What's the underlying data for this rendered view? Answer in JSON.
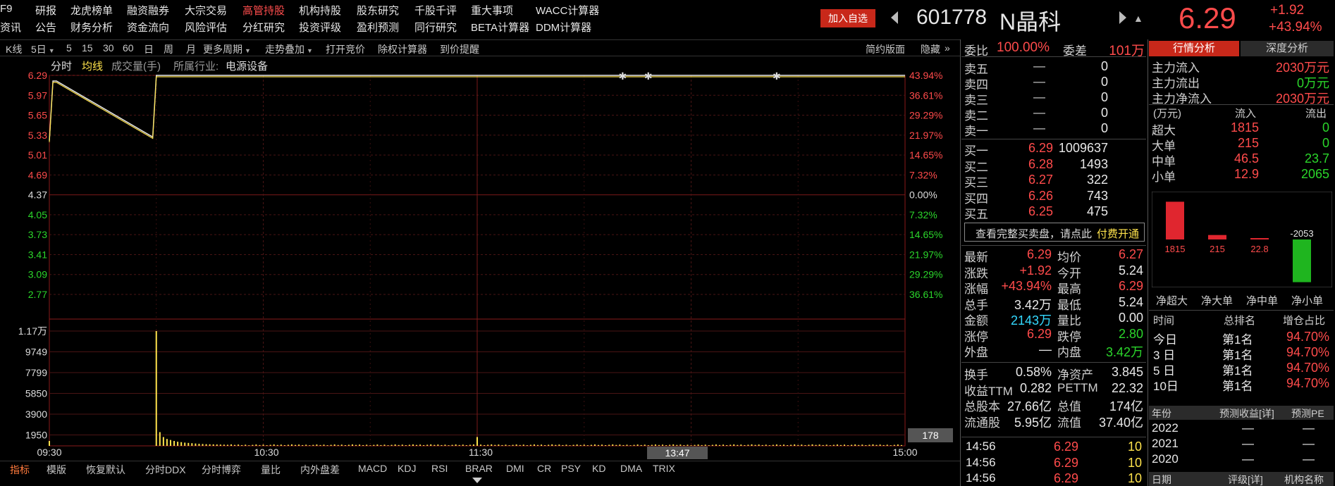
{
  "menu": {
    "row1": [
      {
        "label": "F9",
        "active": false
      },
      {
        "label": "研报",
        "active": false
      },
      {
        "label": "龙虎榜单",
        "active": false
      },
      {
        "label": "融资融券",
        "active": false
      },
      {
        "label": "大宗交易",
        "active": false
      },
      {
        "label": "高管持股",
        "active": true
      },
      {
        "label": "机构持股",
        "active": false
      },
      {
        "label": "股东研究",
        "active": false
      },
      {
        "label": "千股千评",
        "active": false
      },
      {
        "label": "重大事项",
        "active": false
      },
      {
        "label": "WACC计算器",
        "active": false
      }
    ],
    "row2": [
      {
        "label": "资讯"
      },
      {
        "label": "公告"
      },
      {
        "label": "财务分析"
      },
      {
        "label": "资金流向"
      },
      {
        "label": "风险评估"
      },
      {
        "label": "分红研究"
      },
      {
        "label": "投资评级"
      },
      {
        "label": "盈利预测"
      },
      {
        "label": "同行研究"
      },
      {
        "label": "BETA计算器"
      },
      {
        "label": "DDM计算器"
      }
    ]
  },
  "header": {
    "add_watch": "加入自选",
    "code": "601778",
    "name": "N晶科",
    "price": "6.29",
    "change": "+1.92",
    "change_pct": "+43.94%"
  },
  "toolbar": {
    "items": [
      "K线",
      "5日",
      "5",
      "15",
      "30",
      "60",
      "日",
      "周",
      "月",
      "更多周期",
      "走势叠加",
      "打开竞价",
      "除权计算器",
      "到价提醒"
    ],
    "simple_view": "简约版面",
    "hide": "隐藏"
  },
  "chart_header": {
    "fenshi": "分时",
    "junxian": "均线",
    "volume": "成交量(手)",
    "industry_label": "所属行业:",
    "industry": "电源设备"
  },
  "chart_data": {
    "type": "line",
    "price_ticks": [
      "6.29",
      "5.97",
      "5.65",
      "5.33",
      "5.01",
      "4.69",
      "4.37",
      "4.05",
      "3.73",
      "3.41",
      "3.09",
      "2.77"
    ],
    "pct_ticks": [
      "43.94%",
      "36.61%",
      "29.29%",
      "21.97%",
      "14.65%",
      "7.32%",
      "0.00%",
      "7.32%",
      "14.65%",
      "21.97%",
      "29.29%",
      "36.61%"
    ],
    "volume_ticks": [
      "1.17万",
      "9749",
      "7799",
      "5850",
      "3900",
      "1950"
    ],
    "time_ticks": [
      "09:30",
      "10:30",
      "11:30",
      "15:00"
    ],
    "cursor_time": "13:47",
    "cursor_volume": "178",
    "ylim": [
      2.77,
      6.29
    ],
    "series": [
      {
        "values": [
          [
            0,
            5.24
          ],
          [
            1,
            6.2
          ],
          [
            2,
            6.2
          ],
          [
            29,
            5.3
          ],
          [
            30,
            6.29
          ],
          [
            240,
            6.29
          ]
        ]
      }
    ],
    "volume_peak": 11700
  },
  "bottom_tabs": [
    "指标",
    "模版",
    "恢复默认",
    "分时DDX",
    "分时博弈",
    "量比",
    "内外盘差",
    "MACD",
    "KDJ",
    "RSI",
    "BRAR",
    "DMI",
    "CR",
    "PSY",
    "KD",
    "DMA",
    "TRIX"
  ],
  "order_book": {
    "weibi_label": "委比",
    "weibi": "100.00%",
    "weicha_label": "委差",
    "weicha": "101万",
    "sells": [
      {
        "label": "卖五",
        "price": "—",
        "vol": "0"
      },
      {
        "label": "卖四",
        "price": "—",
        "vol": "0"
      },
      {
        "label": "卖三",
        "price": "—",
        "vol": "0"
      },
      {
        "label": "卖二",
        "price": "—",
        "vol": "0"
      },
      {
        "label": "卖一",
        "price": "—",
        "vol": "0"
      }
    ],
    "buys": [
      {
        "label": "买一",
        "price": "6.29",
        "vol": "1009637"
      },
      {
        "label": "买二",
        "price": "6.28",
        "vol": "1493"
      },
      {
        "label": "买三",
        "price": "6.27",
        "vol": "322"
      },
      {
        "label": "买四",
        "price": "6.26",
        "vol": "743"
      },
      {
        "label": "买五",
        "price": "6.25",
        "vol": "475"
      }
    ],
    "full_book_hint": "查看完整买卖盘，请点此",
    "pay_open": "付费开通"
  },
  "quote": {
    "rows": [
      {
        "l1": "最新",
        "v1": "6.29",
        "c1": "red",
        "l2": "均价",
        "v2": "6.27",
        "c2": "red"
      },
      {
        "l1": "涨跌",
        "v1": "+1.92",
        "c1": "red",
        "l2": "今开",
        "v2": "5.24",
        "c2": "white"
      },
      {
        "l1": "涨幅",
        "v1": "+43.94%",
        "c1": "red",
        "l2": "最高",
        "v2": "6.29",
        "c2": "red"
      },
      {
        "l1": "总手",
        "v1": "3.42万",
        "c1": "white",
        "l2": "最低",
        "v2": "5.24",
        "c2": "white"
      },
      {
        "l1": "金额",
        "v1": "2143万",
        "c1": "cyan",
        "l2": "量比",
        "v2": "0.00",
        "c2": "white"
      },
      {
        "l1": "涨停",
        "v1": "6.29",
        "c1": "red",
        "l2": "跌停",
        "v2": "2.80",
        "c2": "green"
      },
      {
        "l1": "外盘",
        "v1": "—",
        "c1": "white",
        "l2": "内盘",
        "v2": "3.42万",
        "c2": "green"
      }
    ],
    "fund_rows": [
      {
        "l1": "换手",
        "v1": "0.58%",
        "l2": "净资产",
        "v2": "3.845"
      },
      {
        "l1": "收益TTM",
        "v1": "0.282",
        "l2": "PETTM",
        "v2": "22.32"
      },
      {
        "l1": "总股本",
        "v1": "27.66亿",
        "l2": "总值",
        "v2": "174亿"
      },
      {
        "l1": "流通股",
        "v1": "5.95亿",
        "l2": "流值",
        "v2": "37.40亿"
      }
    ],
    "ticks": [
      {
        "time": "14:56",
        "price": "6.29",
        "vol": "10"
      },
      {
        "time": "14:56",
        "price": "6.29",
        "vol": "10"
      },
      {
        "time": "14:56",
        "price": "6.29",
        "vol": "10"
      }
    ]
  },
  "right_panel": {
    "tab_active": "行情分析",
    "tab_other": "深度分析",
    "flow": [
      {
        "label": "主力流入",
        "value": "2030万元",
        "color": "red"
      },
      {
        "label": "主力流出",
        "value": "0万元",
        "color": "green"
      },
      {
        "label": "主力净流入",
        "value": "2030万元",
        "color": "red"
      }
    ],
    "unit_label": "(万元)",
    "col_in": "流入",
    "col_out": "流出",
    "orders": [
      {
        "label": "超大",
        "in": "1815",
        "out": "0"
      },
      {
        "label": "大单",
        "in": "215",
        "out": "0"
      },
      {
        "label": "中单",
        "in": "46.5",
        "out": "23.7"
      },
      {
        "label": "小单",
        "in": "12.9",
        "out": "2065"
      }
    ],
    "net_bars": [
      {
        "label": "净超大",
        "value": 1815,
        "text": "1815"
      },
      {
        "label": "净大单",
        "value": 215,
        "text": "215"
      },
      {
        "label": "净中单",
        "value": 22.8,
        "text": "22.8"
      },
      {
        "label": "净小单",
        "value": -2053,
        "text": "-2053"
      }
    ],
    "rank_headers": [
      "时间",
      "总排名",
      "增仓占比"
    ],
    "ranks": [
      {
        "time": "今日",
        "rank": "第1名",
        "pct": "94.70%"
      },
      {
        "time": "3 日",
        "rank": "第1名",
        "pct": "94.70%"
      },
      {
        "time": "5 日",
        "rank": "第1名",
        "pct": "94.70%"
      },
      {
        "time": "10日",
        "rank": "第1名",
        "pct": "94.70%"
      }
    ],
    "forecast_headers": [
      "年份",
      "预测收益[详]",
      "预测PE"
    ],
    "forecast": [
      {
        "year": "2022",
        "eps": "—",
        "pe": "—"
      },
      {
        "year": "2021",
        "eps": "—",
        "pe": "—"
      },
      {
        "year": "2020",
        "eps": "—",
        "pe": "—"
      }
    ],
    "bottom_headers": [
      "日期",
      "评级[详]",
      "机构名称"
    ]
  },
  "colors": {
    "up": "#ff4b4b",
    "down": "#2bd62b",
    "price_line": "#e8e8e8",
    "avg_line": "#ffe34c",
    "volume": "#ffe34c",
    "accent": "#d42a1c"
  }
}
